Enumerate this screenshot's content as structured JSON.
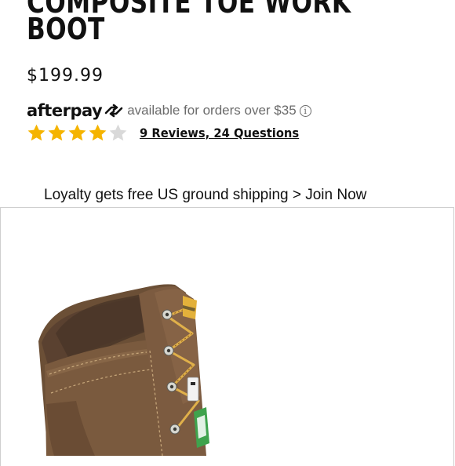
{
  "product": {
    "title_line1": "COMPOSITE TOE WORK",
    "title_line2": "BOOT",
    "price": "$199.99"
  },
  "afterpay": {
    "logo_text": "afterpay",
    "message": "available for orders over $35",
    "info_glyph": "i"
  },
  "rating": {
    "stars_filled": 4,
    "stars_total": 5,
    "star_color": "#f5b400",
    "star_empty_color": "#d9d9d9",
    "reviews_link": "9 Reviews, 24 Questions"
  },
  "promo": {
    "loyalty_text": "Loyalty gets free US ground shipping > Join Now"
  },
  "image": {
    "icon": "boot-product-image"
  }
}
